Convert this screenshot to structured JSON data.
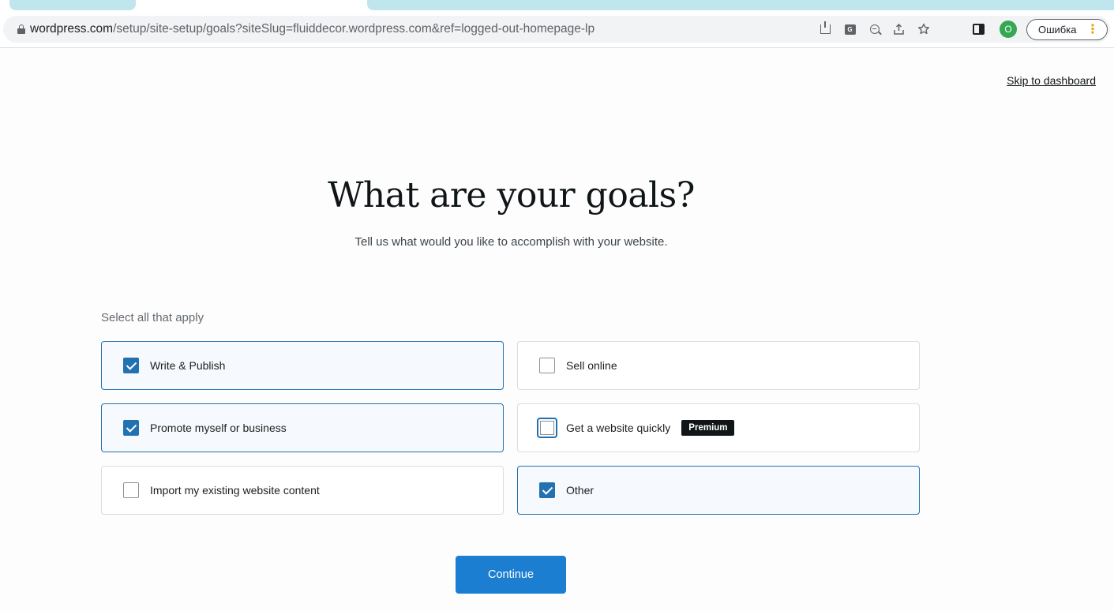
{
  "browser": {
    "url_host": "wordpress.com",
    "url_path": "/setup/site-setup/goals?siteSlug=fluiddecor.wordpress.com&ref=logged-out-homepage-lp",
    "profile_initial": "O",
    "error_button_label": "Ошибка",
    "omnibox_icons": [
      "install-icon",
      "translate-icon",
      "zoom-out-icon",
      "share-icon",
      "bookmark-star-icon"
    ]
  },
  "page": {
    "skip_link": "Skip to dashboard",
    "title": "What are your goals?",
    "subtitle": "Tell us what would you like to accomplish with your website.",
    "select_label": "Select all that apply",
    "goals": [
      {
        "label": "Write & Publish",
        "checked": true
      },
      {
        "label": "Sell online",
        "checked": false
      },
      {
        "label": "Promote myself or business",
        "checked": true
      },
      {
        "label": "Get a website quickly",
        "checked": false,
        "badge": "Premium"
      },
      {
        "label": "Import my existing website content",
        "checked": false
      },
      {
        "label": "Other",
        "checked": true
      }
    ],
    "continue_label": "Continue"
  },
  "colors": {
    "accent": "#2271b1",
    "button": "#1b7ed1",
    "profile": "#34a853"
  }
}
